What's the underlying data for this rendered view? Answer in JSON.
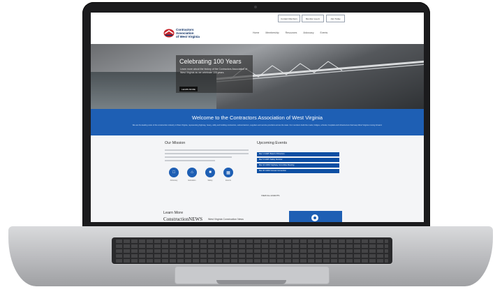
{
  "top_buttons": [
    "Contact Members",
    "Member Log In",
    "Join Today"
  ],
  "brand": {
    "lines": [
      "Contractors",
      "Association",
      "of West Virginia"
    ]
  },
  "nav": [
    "Home",
    "Membership",
    "Resources",
    "Advocacy",
    "Events"
  ],
  "hero": {
    "title": "Celebrating 100 Years",
    "body": "Learn more about the history of the Contractors Association of West Virginia as we celebrate 100 years.",
    "button": "LEARN MORE"
  },
  "welcome": {
    "title": "Welcome to the Contractors Association of West Virginia",
    "body": "We are the leading voice of the construction industry in West Virginia, representing highway, heavy, utility and building contractors, subcontractors, suppliers and service providers across the state. Our members build the roads, bridges, schools, hospitals and infrastructure that keep West Virginia moving forward."
  },
  "mission": {
    "title": "Our Mission",
    "icons": [
      {
        "label": "Advocacy",
        "icon": "building-icon"
      },
      {
        "label": "Education",
        "icon": "home-icon"
      },
      {
        "label": "Safety",
        "icon": "shield-icon"
      },
      {
        "label": "Events",
        "icon": "calendar-icon"
      }
    ]
  },
  "events": {
    "title": "Upcoming Events",
    "items": [
      "Mar 1 CAWV Board of Directors",
      "Mar 5 CAWV Safety Seminar",
      "Mar 12 CAWV Highway Committee Meeting",
      "Mar 20 CAWV Annual Convention"
    ],
    "view_all": "VIEW ALL EVENTS"
  },
  "learn_more": {
    "title": "Learn More",
    "news_logo": "ConstructionNEWS",
    "news_title": "West Virginia Construction News"
  },
  "colors": {
    "brand_blue": "#1e5fb4",
    "navy": "#0b2d63",
    "accent_red": "#c8262c"
  }
}
